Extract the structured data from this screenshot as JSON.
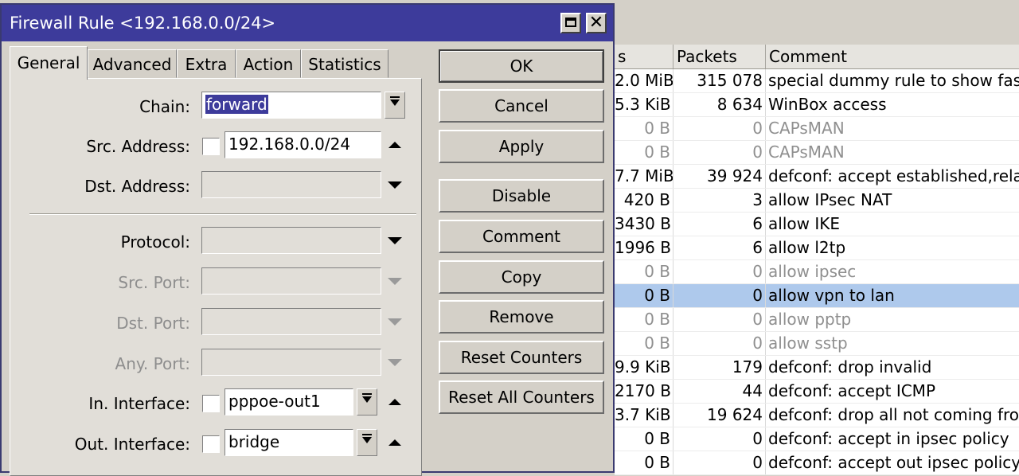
{
  "window": {
    "title": "Firewall Rule <192.168.0.0/24>",
    "maximize_icon": "maximize-icon",
    "close_icon": "close-icon",
    "close_glyph": "✕"
  },
  "tabs": [
    {
      "label": "General",
      "active": true
    },
    {
      "label": "Advanced",
      "active": false
    },
    {
      "label": "Extra",
      "active": false
    },
    {
      "label": "Action",
      "active": false
    },
    {
      "label": "Statistics",
      "active": false
    }
  ],
  "form": {
    "chain": {
      "label": "Chain:",
      "value": "forward"
    },
    "src_address": {
      "label": "Src. Address:",
      "value": "192.168.0.0/24"
    },
    "dst_address": {
      "label": "Dst. Address:",
      "value": ""
    },
    "protocol": {
      "label": "Protocol:",
      "value": ""
    },
    "src_port": {
      "label": "Src. Port:",
      "value": ""
    },
    "dst_port": {
      "label": "Dst. Port:",
      "value": ""
    },
    "any_port": {
      "label": "Any. Port:",
      "value": ""
    },
    "in_interface": {
      "label": "In. Interface:",
      "value": "pppoe-out1"
    },
    "out_interface": {
      "label": "Out. Interface:",
      "value": "bridge"
    }
  },
  "buttons": {
    "ok": "OK",
    "cancel": "Cancel",
    "apply": "Apply",
    "disable": "Disable",
    "comment": "Comment",
    "copy": "Copy",
    "remove": "Remove",
    "reset_counters": "Reset Counters",
    "reset_all_counters": "Reset All Counters"
  },
  "table": {
    "columns": [
      "s",
      "Packets",
      "Comment"
    ],
    "rows": [
      {
        "bytes": "2.0 MiB",
        "packets": "315 078",
        "comment": "special dummy rule to show fasttr",
        "disabled": false,
        "selected": false
      },
      {
        "bytes": "5.3 KiB",
        "packets": "8 634",
        "comment": "WinBox access",
        "disabled": false,
        "selected": false
      },
      {
        "bytes": "0 B",
        "packets": "0",
        "comment": "CAPsMAN",
        "disabled": true,
        "selected": false
      },
      {
        "bytes": "0 B",
        "packets": "0",
        "comment": "CAPsMAN",
        "disabled": true,
        "selected": false
      },
      {
        "bytes": "7.7 MiB",
        "packets": "39 924",
        "comment": "defconf: accept established,relate",
        "disabled": false,
        "selected": false
      },
      {
        "bytes": "420 B",
        "packets": "3",
        "comment": "allow IPsec NAT",
        "disabled": false,
        "selected": false
      },
      {
        "bytes": "3430 B",
        "packets": "6",
        "comment": "allow IKE",
        "disabled": false,
        "selected": false
      },
      {
        "bytes": "1996 B",
        "packets": "6",
        "comment": "allow l2tp",
        "disabled": false,
        "selected": false
      },
      {
        "bytes": "0 B",
        "packets": "0",
        "comment": "allow ipsec",
        "disabled": true,
        "selected": false
      },
      {
        "bytes": "0 B",
        "packets": "0",
        "comment": "allow vpn to lan",
        "disabled": false,
        "selected": true
      },
      {
        "bytes": "0 B",
        "packets": "0",
        "comment": "allow pptp",
        "disabled": true,
        "selected": false
      },
      {
        "bytes": "0 B",
        "packets": "0",
        "comment": "allow sstp",
        "disabled": true,
        "selected": false
      },
      {
        "bytes": "9.9 KiB",
        "packets": "179",
        "comment": "defconf: drop invalid",
        "disabled": false,
        "selected": false
      },
      {
        "bytes": "2170 B",
        "packets": "44",
        "comment": "defconf: accept ICMP",
        "disabled": false,
        "selected": false
      },
      {
        "bytes": "3.7 KiB",
        "packets": "19 624",
        "comment": "defconf: drop all not coming from",
        "disabled": false,
        "selected": false
      },
      {
        "bytes": "0 B",
        "packets": "0",
        "comment": "defconf: accept in ipsec policy",
        "disabled": false,
        "selected": false
      },
      {
        "bytes": "0 B",
        "packets": "0",
        "comment": "defconf: accept out ipsec policy",
        "disabled": false,
        "selected": false
      }
    ]
  },
  "colors": {
    "titlebar": "#3d3b9b",
    "selected_row": "#aec9ec",
    "disabled_text": "#8f8f8f"
  }
}
